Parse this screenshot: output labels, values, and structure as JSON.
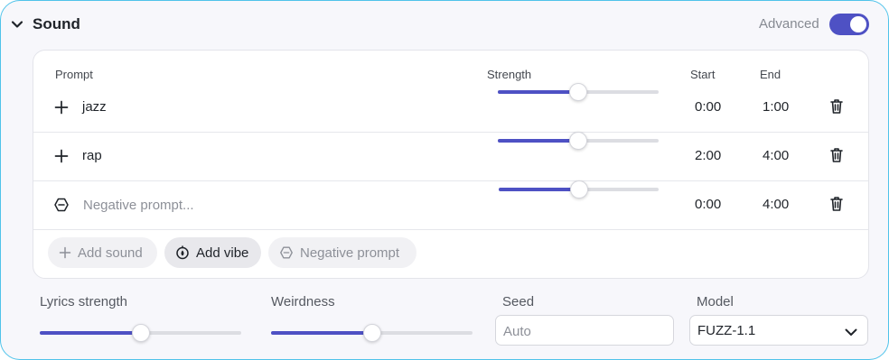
{
  "header": {
    "title": "Sound",
    "advanced_label": "Advanced",
    "advanced_on": true
  },
  "table": {
    "columns": {
      "prompt": "Prompt",
      "strength": "Strength",
      "start": "Start",
      "end": "End"
    },
    "rows": [
      {
        "prompt": "jazz",
        "strength": 0.5,
        "start": "0:00",
        "end": "1:00"
      },
      {
        "prompt": "rap",
        "strength": 0.5,
        "start": "2:00",
        "end": "4:00"
      },
      {
        "prompt": "",
        "placeholder": "Negative prompt...",
        "strength": 0.5,
        "start": "0:00",
        "end": "4:00"
      }
    ]
  },
  "actions": {
    "add_sound": "Add sound",
    "add_vibe": "Add vibe",
    "negative_prompt": "Negative prompt"
  },
  "controls": {
    "lyrics_strength": {
      "label": "Lyrics strength",
      "value": 0.5
    },
    "weirdness": {
      "label": "Weirdness",
      "value": 0.5
    },
    "seed": {
      "label": "Seed",
      "value": "",
      "placeholder": "Auto"
    },
    "model": {
      "label": "Model",
      "value": "FUZZ-1.1"
    }
  },
  "colors": {
    "accent": "#4e51c4",
    "panel_border": "#4fc3ea",
    "panel_bg": "#f7f7fb"
  },
  "icons": [
    "chevron-down-icon",
    "plus-icon",
    "negative-icon",
    "trash-icon",
    "vibe-icon"
  ]
}
